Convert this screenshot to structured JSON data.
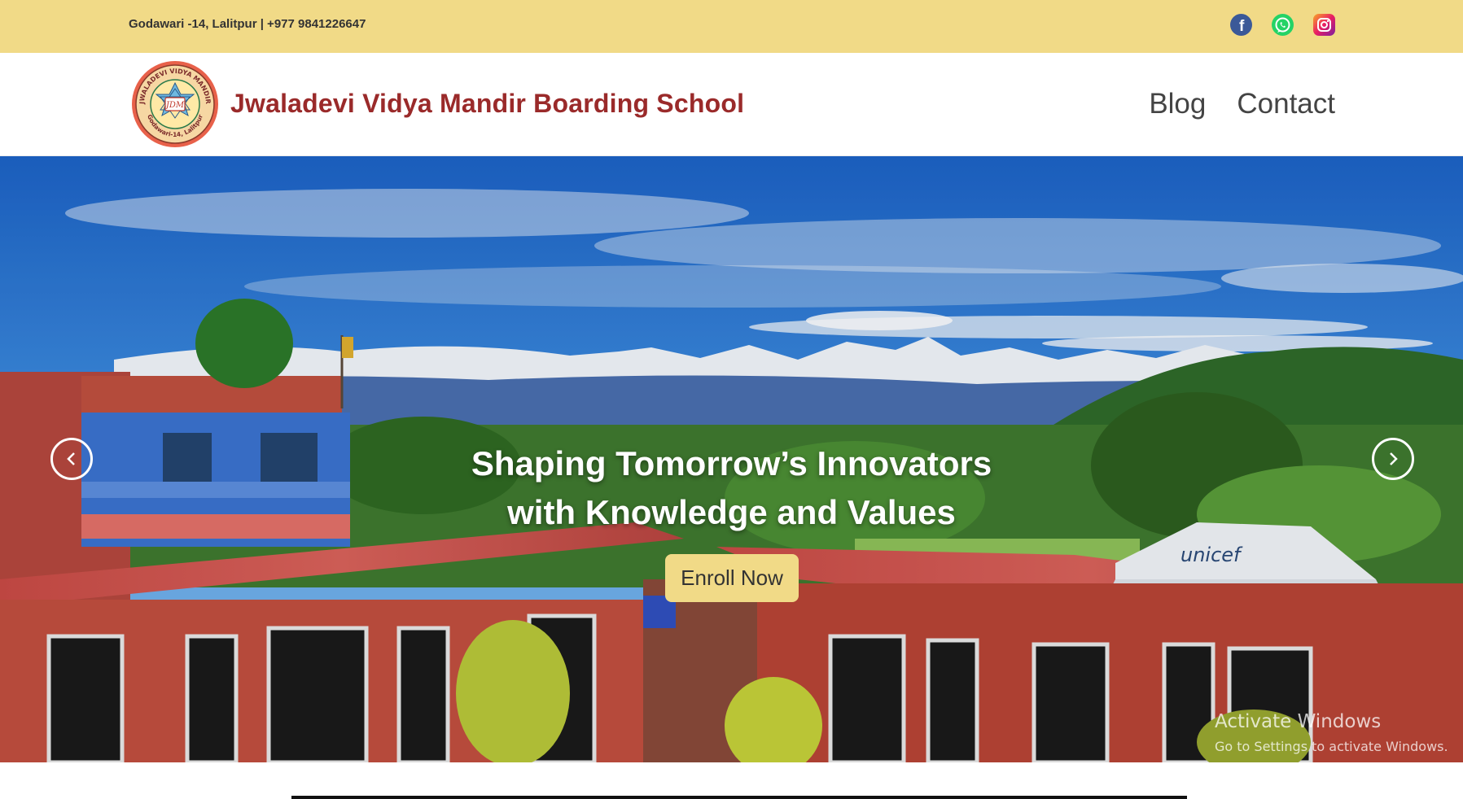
{
  "topbar": {
    "address": "Godawari -14, Lalitpur | +977 9841226647",
    "socials": [
      {
        "name": "facebook",
        "icon": "facebook-icon"
      },
      {
        "name": "whatsapp",
        "icon": "whatsapp-icon"
      },
      {
        "name": "instagram",
        "icon": "instagram-icon"
      }
    ]
  },
  "header": {
    "logo": {
      "ring_text_top": "JWALADEVI VIDYA MANDIR",
      "ring_text_bottom": "Godawari-14, Lalitpur",
      "monogram": "JDM"
    },
    "school_name": "Jwaladevi Vidya Mandir Boarding School",
    "nav": [
      {
        "label": "Blog"
      },
      {
        "label": "Contact"
      }
    ]
  },
  "hero": {
    "headline_line1": "Shaping Tomorrow’s Innovators",
    "headline_line2": "with Knowledge and Values",
    "cta_label": "Enroll Now",
    "tent_label": "unicef",
    "prev_icon": "chevron-left-icon",
    "next_icon": "chevron-right-icon"
  },
  "watermark": {
    "line1": "Activate Windows",
    "line2": "Go to Settings to activate Windows."
  },
  "colors": {
    "topbar_bg": "#f1da87",
    "brand_red": "#9a2a2a",
    "nav_text": "#444444",
    "cta_bg": "#f1da87"
  }
}
